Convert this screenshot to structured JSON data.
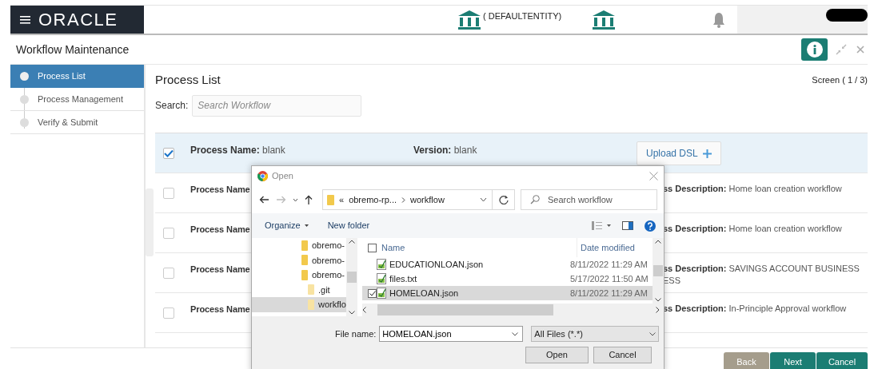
{
  "header": {
    "logo": "ORACLE",
    "entity": "( DEFAULTENTITY)"
  },
  "page_title": "Workflow Maintenance",
  "steps": [
    {
      "label": "Process List",
      "selected": true
    },
    {
      "label": "Process Management",
      "selected": false
    },
    {
      "label": "Verify & Submit",
      "selected": false
    }
  ],
  "content": {
    "title": "Process List",
    "screen": "Screen ( 1 / 3)",
    "search_label": "Search:",
    "search_placeholder": "Search Workflow"
  },
  "rows": [
    {
      "selected": true,
      "checked": true,
      "name_label": "Process Name:",
      "name_value": "blank",
      "version_label": "Version:",
      "version_value": "blank",
      "upload": "Upload DSL"
    },
    {
      "selected": false,
      "checked": false,
      "name_label": "Process Name",
      "desc_label": "ss Description:",
      "desc_value": "Home loan creation workflow"
    },
    {
      "selected": false,
      "checked": false,
      "name_label": "Process Name",
      "desc_label": "ss Description:",
      "desc_value": "Home loan creation workflow"
    },
    {
      "selected": false,
      "checked": false,
      "name_label": "Process Name",
      "desc_label": "ss Description:",
      "desc_value": "SAVINGS ACCOUNT BUSINESS ESS"
    },
    {
      "selected": false,
      "checked": false,
      "name_label": "Process Name",
      "desc_label": "ss Description:",
      "desc_value": "In-Principle Approval workflow"
    }
  ],
  "dialog": {
    "title": "Open",
    "path_prefix": "«",
    "path": [
      "obremo-rp...",
      "workflow"
    ],
    "search_placeholder": "Search workflow",
    "toolbar": [
      "Organize",
      "New folder"
    ],
    "tree": [
      {
        "label": "obremo-",
        "selected": false
      },
      {
        "label": "obremo-",
        "selected": false
      },
      {
        "label": "obremo-",
        "selected": false,
        "children": [
          {
            "label": ".git",
            "selected": false
          },
          {
            "label": "workflo",
            "selected": true
          }
        ]
      }
    ],
    "columns": [
      "Name",
      "Date modified"
    ],
    "select_all_checked": false,
    "files": [
      {
        "name": "EDUCATIONLOAN.json",
        "date": "8/11/2022 11:29 AM",
        "selected": false,
        "checked": false
      },
      {
        "name": "files.txt",
        "date": "5/17/2022 11:50 AM",
        "selected": false,
        "checked": false
      },
      {
        "name": "HOMELOAN.json",
        "date": "8/11/2022 11:29 AM",
        "selected": true,
        "checked": true
      }
    ],
    "file_name_label": "File name:",
    "file_name": "HOMELOAN.json",
    "filter": "All Files (*.*)",
    "buttons": [
      "Open",
      "Cancel"
    ]
  },
  "footer": {
    "buttons": [
      {
        "label": "Back",
        "disabled": true
      },
      {
        "label": "Next",
        "disabled": false
      },
      {
        "label": "Cancel",
        "disabled": false
      }
    ]
  }
}
